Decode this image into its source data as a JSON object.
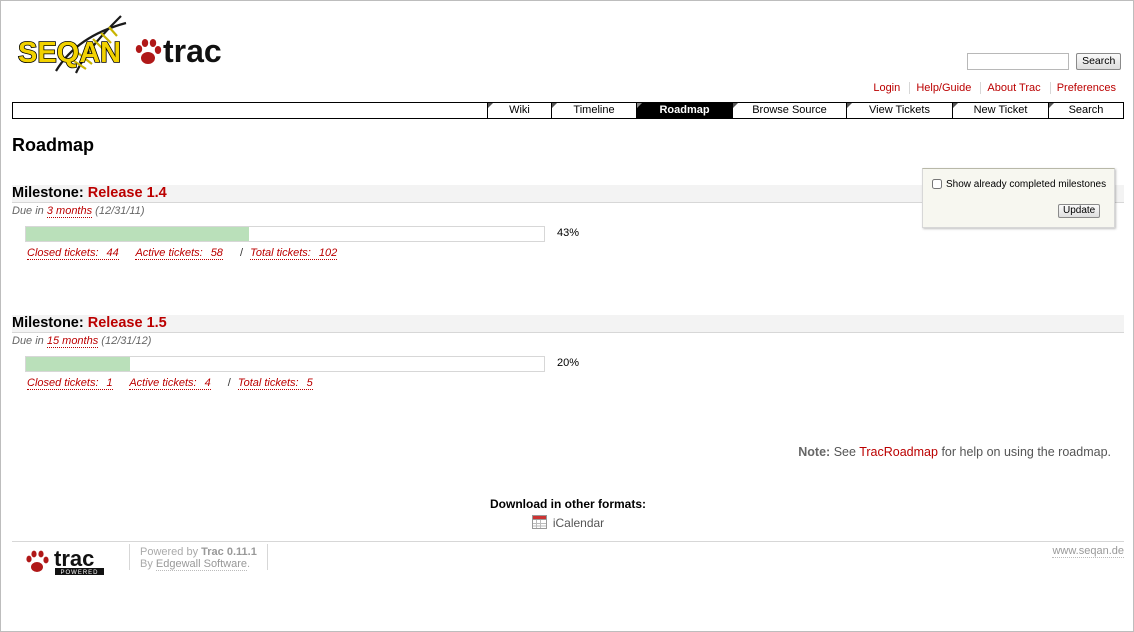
{
  "logo": {
    "brand_text": "SEQAN",
    "product_text": "trac"
  },
  "search": {
    "query": "",
    "button_label": "Search"
  },
  "metanav": [
    "Login",
    "Help/Guide",
    "About Trac",
    "Preferences"
  ],
  "mainnav": [
    {
      "label": "Wiki",
      "active": false
    },
    {
      "label": "Timeline",
      "active": false
    },
    {
      "label": "Roadmap",
      "active": true
    },
    {
      "label": "Browse Source",
      "active": false
    },
    {
      "label": "View Tickets",
      "active": false
    },
    {
      "label": "New Ticket",
      "active": false
    },
    {
      "label": "Search",
      "active": false
    }
  ],
  "page_title": "Roadmap",
  "milestone_prefix": "Milestone:",
  "milestones": [
    {
      "name": "Release 1.4",
      "due_prefix": "Due in",
      "due_rel": "3 months",
      "due_date": "(12/31/11)",
      "percent": 43,
      "percent_label": "43%",
      "closed_label": "Closed tickets:",
      "closed": "44",
      "active_label": "Active tickets:",
      "active": "58",
      "total_label": "Total tickets:",
      "total": "102"
    },
    {
      "name": "Release 1.5",
      "due_prefix": "Due in",
      "due_rel": "15 months",
      "due_date": "(12/31/12)",
      "percent": 20,
      "percent_label": "20%",
      "closed_label": "Closed tickets:",
      "closed": "1",
      "active_label": "Active tickets:",
      "active": "4",
      "total_label": "Total tickets:",
      "total": "5"
    }
  ],
  "options": {
    "show_completed_label": "Show already completed milestones",
    "show_completed": false,
    "update_label": "Update"
  },
  "note": {
    "label": "Note:",
    "before": "See",
    "link": "TracRoadmap",
    "after": "for help on using the roadmap."
  },
  "download": {
    "title": "Download in other formats:",
    "icalendar": "iCalendar"
  },
  "footer": {
    "trac_text": "trac",
    "powered_badge": "POWERED",
    "powered_by": "Powered by",
    "version_link": "Trac 0.11.1",
    "by": "By",
    "edgewall": "Edgewall Software",
    "site": "www.seqan.de"
  },
  "colors": {
    "link": "#bb0000",
    "progress_fill": "#bae0ba",
    "nav_active_bg": "#000000"
  }
}
